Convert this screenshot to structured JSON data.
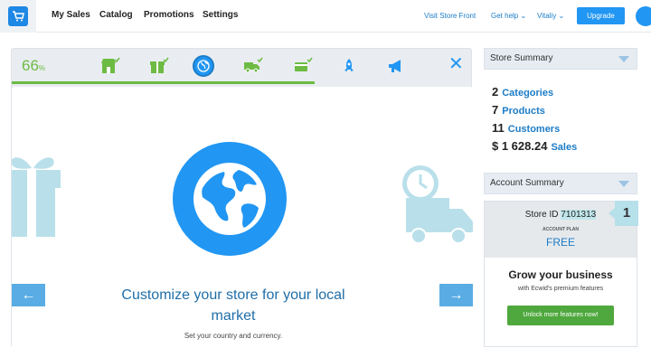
{
  "topnav": {
    "items": [
      "My Sales",
      "Catalog",
      "Promotions",
      "Settings"
    ],
    "visit_store": "Visit Store Front",
    "get_help": "Get help",
    "user": "Vitaliy",
    "upgrade": "Upgrade"
  },
  "wizard": {
    "percent": "66",
    "percent_sign": "%",
    "progress": 0.66,
    "steps": [
      {
        "icon": "store-icon",
        "done": true
      },
      {
        "icon": "gift-icon",
        "done": true
      },
      {
        "icon": "globe-icon",
        "done": false,
        "active": true
      },
      {
        "icon": "truck-icon",
        "done": true
      },
      {
        "icon": "card-icon",
        "done": true
      },
      {
        "icon": "rocket-icon",
        "done": false
      },
      {
        "icon": "megaphone-icon",
        "done": false
      }
    ],
    "title": "Customize your store for your local market",
    "subtitle": "Set your country and currency."
  },
  "store_summary": {
    "header": "Store Summary",
    "categories": {
      "count": "2",
      "label": "Categories"
    },
    "products": {
      "count": "7",
      "label": "Products"
    },
    "customers": {
      "count": "11",
      "label": "Customers"
    },
    "sales": {
      "count": "$ 1 628.24",
      "label": "Sales"
    }
  },
  "account_summary": {
    "header": "Account Summary",
    "store_id_label": "Store ID",
    "store_id": "7101313",
    "plan_label": "ACCOUNT PLAN",
    "plan": "FREE",
    "grow_title": "Grow your business",
    "grow_sub": "with Ecwid's premium features",
    "unlock": "Unlock more features now!",
    "badge": "1"
  },
  "colors": {
    "accent": "#2196f3",
    "green": "#6dbb43",
    "link": "#1c7cc7"
  }
}
